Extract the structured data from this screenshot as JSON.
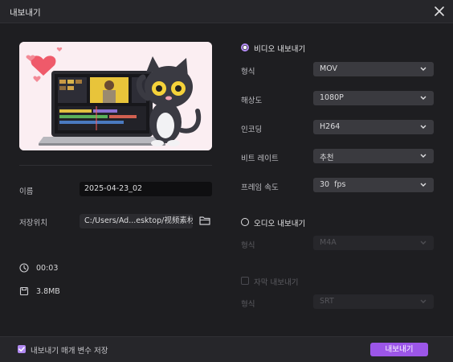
{
  "dialog": {
    "title": "내보내기"
  },
  "file": {
    "name_label": "이름",
    "name_value": "2025-04-23_02",
    "location_label": "저장위치",
    "location_value": "C:/Users/Ad...esktop/视频素材",
    "duration": "00:03",
    "size": "3.8MB"
  },
  "video": {
    "section_label": "비디오 내보내기",
    "selected": true,
    "format_label": "형식",
    "format_value": "MOV",
    "resolution_label": "해상도",
    "resolution_value": "1080P",
    "encoding_label": "인코딩",
    "encoding_value": "H264",
    "bitrate_label": "비트 레이트",
    "bitrate_value": "추천",
    "framerate_label": "프레임 속도",
    "framerate_value": "30  fps"
  },
  "audio": {
    "section_label": "오디오 내보내기",
    "selected": false,
    "format_label": "형식",
    "format_value": "M4A"
  },
  "subtitle": {
    "checkbox_label": "자막 내보내기",
    "checked": false,
    "format_label": "형식",
    "format_value": "SRT"
  },
  "footer": {
    "remember_label": "내보내기 매개 변수 저장",
    "remember_checked": true,
    "export_button": "내보내기"
  },
  "colors": {
    "accent": "#9c56e8",
    "accent_light": "#b48cf5"
  }
}
